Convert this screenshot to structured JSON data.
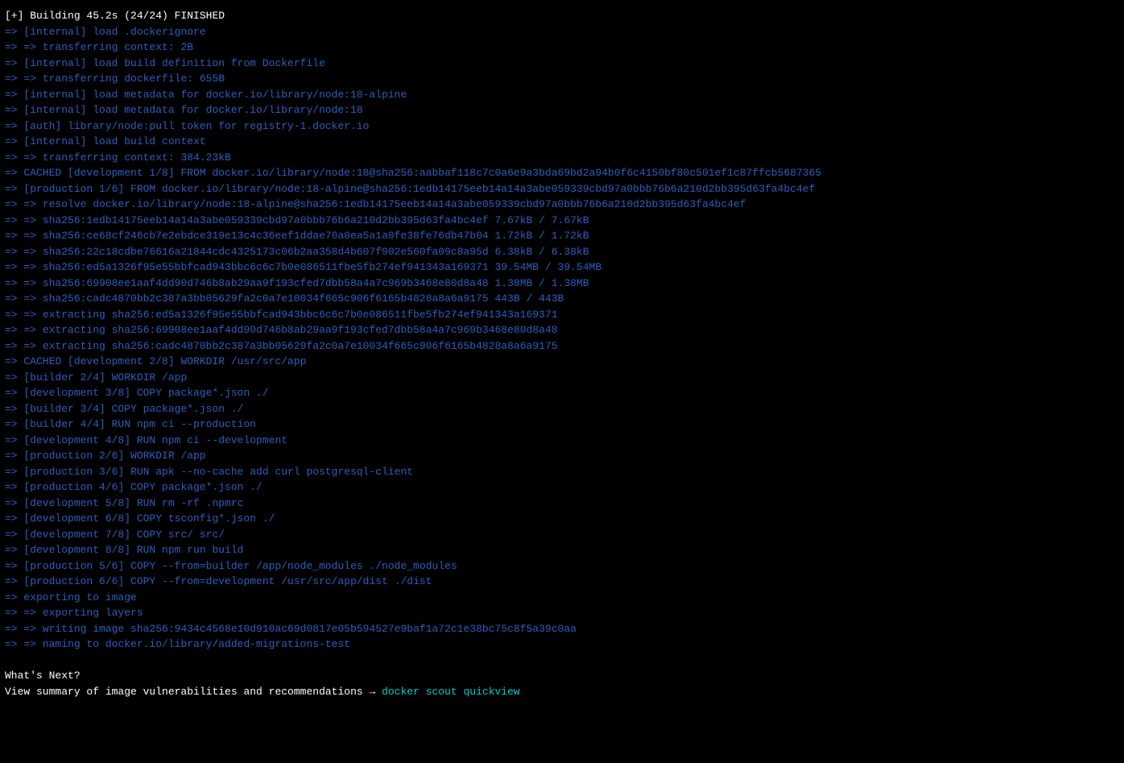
{
  "header": "[+] Building 45.2s (24/24) FINISHED",
  "lines": [
    {
      "prefix": "=>",
      "text": "[internal] load .dockerignore"
    },
    {
      "prefix": "=> =>",
      "text": "transferring context: 2B"
    },
    {
      "prefix": "=>",
      "text": "[internal] load build definition from Dockerfile"
    },
    {
      "prefix": "=> =>",
      "text": "transferring dockerfile: 655B"
    },
    {
      "prefix": "=>",
      "text": "[internal] load metadata for docker.io/library/node:18-alpine"
    },
    {
      "prefix": "=>",
      "text": "[internal] load metadata for docker.io/library/node:18"
    },
    {
      "prefix": "=>",
      "text": "[auth] library/node:pull token for registry-1.docker.io"
    },
    {
      "prefix": "=>",
      "text": "[internal] load build context"
    },
    {
      "prefix": "=> =>",
      "text": "transferring context: 384.23kB"
    },
    {
      "prefix": "=>",
      "text": "CACHED [development 1/8] FROM docker.io/library/node:18@sha256:aabbaf118c7c0a6e9a3bda69bd2a94b0f6c4150bf80c501ef1c87ffcb5687365"
    },
    {
      "prefix": "=>",
      "text": "[production 1/6] FROM docker.io/library/node:18-alpine@sha256:1edb14175eeb14a14a3abe059339cbd97a0bbb76b6a210d2bb395d63fa4bc4ef"
    },
    {
      "prefix": "=> =>",
      "text": "resolve docker.io/library/node:18-alpine@sha256:1edb14175eeb14a14a3abe059339cbd97a0bbb76b6a210d2bb395d63fa4bc4ef"
    },
    {
      "prefix": "=> =>",
      "text": "sha256:1edb14175eeb14a14a3abe059339cbd97a0bbb76b6a210d2bb395d63fa4bc4ef 7.67kB / 7.67kB"
    },
    {
      "prefix": "=> =>",
      "text": "sha256:ce68cf246cb7e2ebdce319e13c4c36eef1ddae70a0ea5a1a0fe38fe76db47b04 1.72kB / 1.72kB"
    },
    {
      "prefix": "=> =>",
      "text": "sha256:22c18cdbe76616a21844cdc4325173c06b2aa358d4b607f902e560fa09c8a95d 6.38kB / 6.38kB"
    },
    {
      "prefix": "=> =>",
      "text": "sha256:ed5a1326f95e55bbfcad943bbc6c6c7b0e086511fbe5fb274ef941343a169371 39.54MB / 39.54MB"
    },
    {
      "prefix": "=> =>",
      "text": "sha256:69908ee1aaf4dd90d746b8ab29aa9f193cfed7dbb58a4a7c969b3468e80d8a48 1.38MB / 1.38MB"
    },
    {
      "prefix": "=> =>",
      "text": "sha256:cadc4870bb2c387a3bb05629fa2c0a7e10034f665c906f6165b4828a8a6a9175 443B / 443B"
    },
    {
      "prefix": "=> =>",
      "text": "extracting sha256:ed5a1326f95e55bbfcad943bbc6c6c7b0e086511fbe5fb274ef941343a169371"
    },
    {
      "prefix": "=> =>",
      "text": "extracting sha256:69908ee1aaf4dd90d746b8ab29aa9f193cfed7dbb58a4a7c969b3468e80d8a48"
    },
    {
      "prefix": "=> =>",
      "text": "extracting sha256:cadc4870bb2c387a3bb05629fa2c0a7e10034f665c906f6165b4828a8a6a9175"
    },
    {
      "prefix": "=>",
      "text": "CACHED [development 2/8] WORKDIR /usr/src/app"
    },
    {
      "prefix": "=>",
      "text": "[builder 2/4] WORKDIR /app"
    },
    {
      "prefix": "=>",
      "text": "[development 3/8] COPY package*.json ./"
    },
    {
      "prefix": "=>",
      "text": "[builder 3/4] COPY package*.json ./"
    },
    {
      "prefix": "=>",
      "text": "[builder 4/4] RUN npm ci --production"
    },
    {
      "prefix": "=>",
      "text": "[development 4/8] RUN npm ci --development"
    },
    {
      "prefix": "=>",
      "text": "[production 2/6] WORKDIR /app"
    },
    {
      "prefix": "=>",
      "text": "[production 3/6] RUN apk --no-cache add curl postgresql-client"
    },
    {
      "prefix": "=>",
      "text": "[production 4/6] COPY package*.json ./"
    },
    {
      "prefix": "=>",
      "text": "[development 5/8] RUN rm -rf .npmrc"
    },
    {
      "prefix": "=>",
      "text": "[development 6/8] COPY tsconfig*.json ./"
    },
    {
      "prefix": "=>",
      "text": "[development 7/8] COPY src/ src/"
    },
    {
      "prefix": "=>",
      "text": "[development 8/8] RUN npm run build"
    },
    {
      "prefix": "=>",
      "text": "[production 5/6] COPY --from=builder /app/node_modules ./node_modules"
    },
    {
      "prefix": "=>",
      "text": "[production 6/6] COPY --from=development /usr/src/app/dist ./dist"
    },
    {
      "prefix": "=>",
      "text": "exporting to image"
    },
    {
      "prefix": "=> =>",
      "text": "exporting layers"
    },
    {
      "prefix": "=> =>",
      "text": "writing image sha256:9434c4568e10d910ac69d0817e05b594527e9baf1a72c1e38bc75c8f5a39c0aa"
    },
    {
      "prefix": "=> =>",
      "text": "naming to docker.io/library/added-migrations-test"
    }
  ],
  "footer": {
    "whats_next": "What's Next?",
    "summary_prefix": "  View summary of image vulnerabilities and recommendations → ",
    "scout_cmd": "docker scout quickview"
  }
}
